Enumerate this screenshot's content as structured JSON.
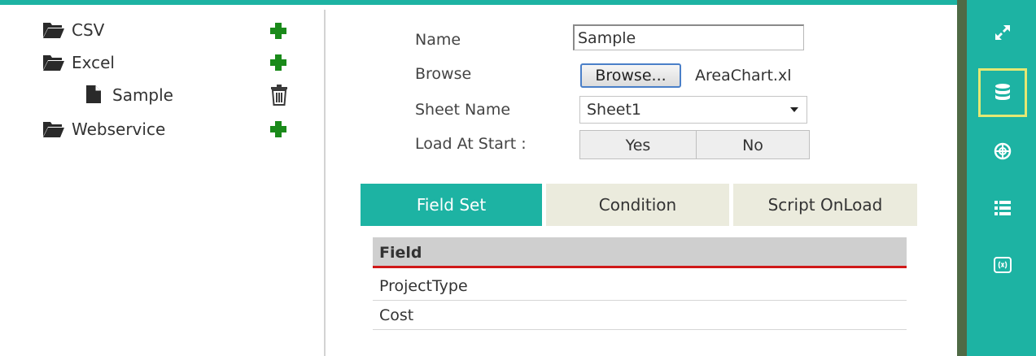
{
  "tree": {
    "items": [
      {
        "label": "CSV",
        "icon": "folder-open-icon",
        "action": "plus-icon"
      },
      {
        "label": "Excel",
        "icon": "folder-open-icon",
        "action": "plus-icon"
      },
      {
        "label": "Sample",
        "icon": "file-icon",
        "action": "trash-icon"
      },
      {
        "label": "Webservice",
        "icon": "folder-open-icon",
        "action": "plus-icon"
      }
    ]
  },
  "form": {
    "name_label": "Name",
    "name_value": "Sample",
    "browse_label": "Browse",
    "browse_button": "Browse...",
    "file_name": "AreaChart.xl",
    "sheet_label": "Sheet Name",
    "sheet_value": "Sheet1",
    "load_label": "Load At Start :",
    "yes": "Yes",
    "no": "No"
  },
  "tabs": [
    {
      "label": "Field Set",
      "active": true
    },
    {
      "label": "Condition",
      "active": false
    },
    {
      "label": "Script OnLoad",
      "active": false
    }
  ],
  "table": {
    "header": "Field",
    "rows": [
      "ProjectType",
      "Cost"
    ]
  },
  "rightbar": {
    "items": [
      "expand-icon",
      "database-icon",
      "target-icon",
      "list-icon",
      "function-icon"
    ],
    "selected": "database-icon"
  },
  "colors": {
    "accent": "#1db3a3",
    "highlight": "#e4e873",
    "header_underline": "#d01818",
    "add_green": "#1a8a1a"
  }
}
